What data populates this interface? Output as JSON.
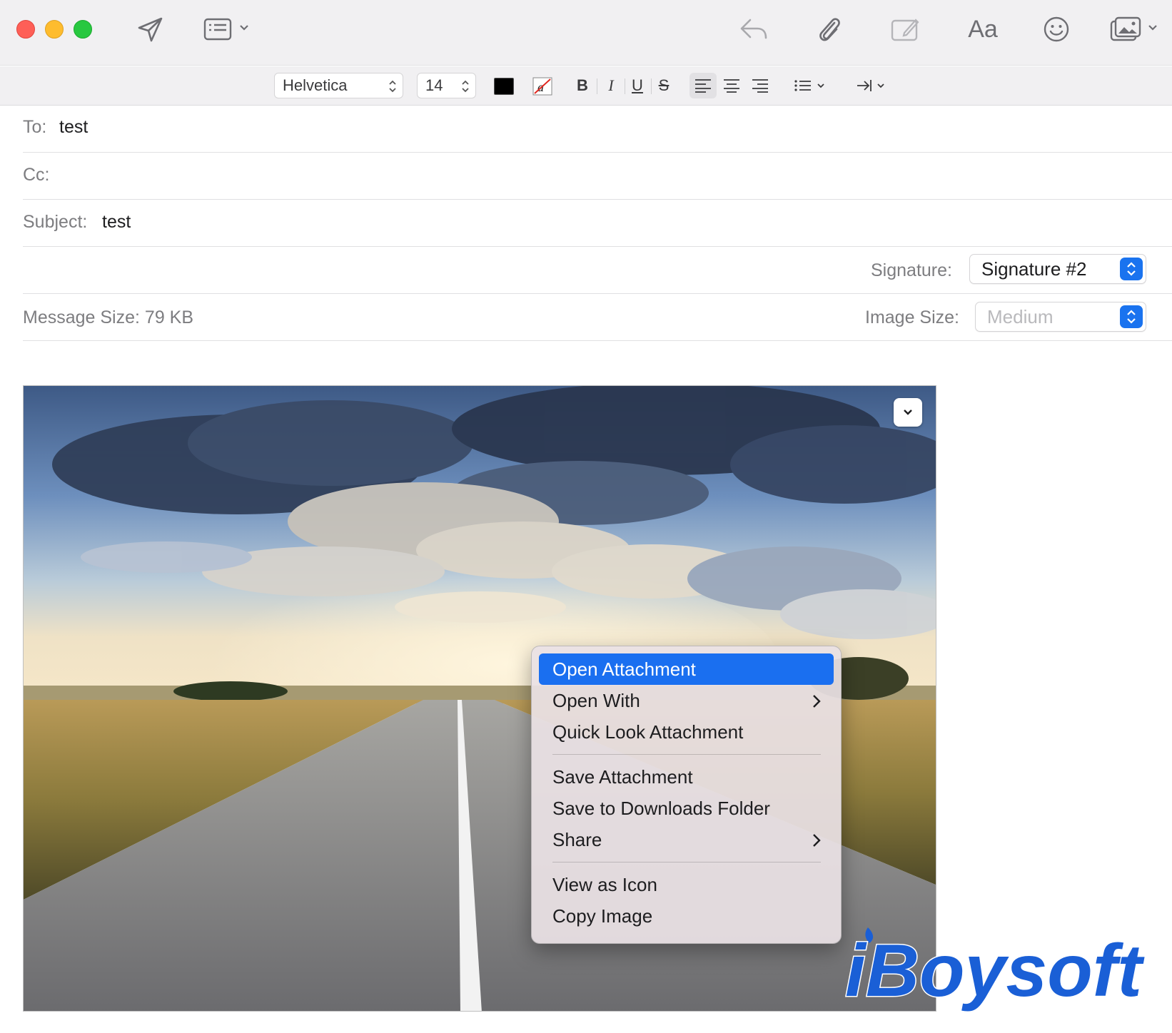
{
  "window": {
    "traffic_lights": [
      "close-button",
      "minimize-button",
      "zoom-button"
    ]
  },
  "toolbar": {
    "icons": [
      "send-icon",
      "header-fields-icon",
      "reply-icon",
      "attach-icon",
      "markup-icon",
      "format-icon",
      "emoji-icon",
      "photo-browser-icon"
    ],
    "format_label": "Aa"
  },
  "format_bar": {
    "font": "Helvetica",
    "size": "14",
    "bold": "B",
    "italic": "I",
    "underline": "U",
    "strikethrough": "S",
    "text_color": "#000000"
  },
  "fields": {
    "to_label": "To:",
    "to_value": "test",
    "cc_label": "Cc:",
    "cc_value": "",
    "subject_label": "Subject:",
    "subject_value": "test",
    "signature_label": "Signature:",
    "signature_value": "Signature #2",
    "message_size": "Message Size: 79 KB",
    "image_size_label": "Image Size:",
    "image_size_value": "Medium"
  },
  "context_menu": {
    "items": [
      {
        "label": "Open Attachment",
        "highlighted": true,
        "submenu": false
      },
      {
        "label": "Open With",
        "highlighted": false,
        "submenu": true
      },
      {
        "label": "Quick Look Attachment",
        "highlighted": false,
        "submenu": false
      },
      {
        "label": "Save Attachment",
        "highlighted": false,
        "submenu": false
      },
      {
        "label": "Save to Downloads Folder",
        "highlighted": false,
        "submenu": false
      },
      {
        "label": "Share",
        "highlighted": false,
        "submenu": true
      },
      {
        "label": "View as Icon",
        "highlighted": false,
        "submenu": false
      },
      {
        "label": "Copy Image",
        "highlighted": false,
        "submenu": false
      }
    ]
  },
  "watermark": {
    "text": "iBoysoft",
    "color": "#1a5fd6"
  },
  "colors": {
    "accent": "#1a6ff0",
    "toolbar_bg": "#f1f0f2",
    "label_gray": "#7d7d80"
  }
}
